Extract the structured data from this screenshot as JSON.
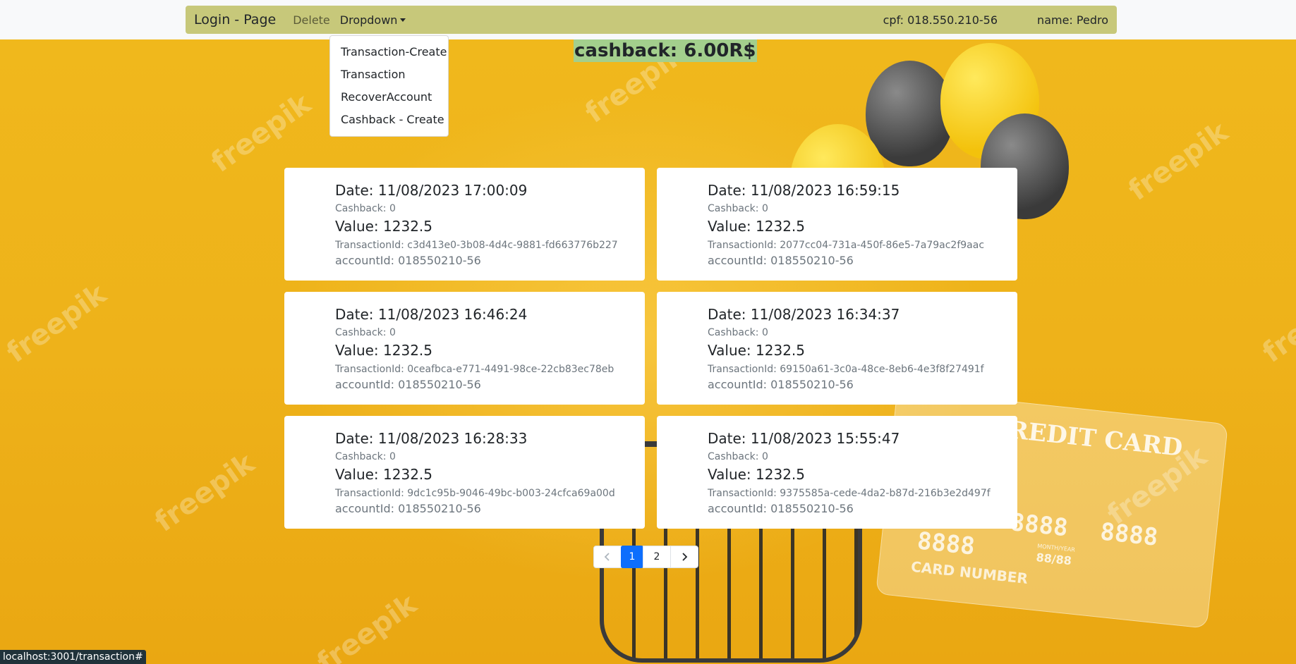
{
  "navbar": {
    "brand": "Login - Page",
    "delete_label": "Delete",
    "dropdown_label": "Dropdown",
    "cpf": "cpf: 018.550.210-56",
    "name": "name: Pedro"
  },
  "dropdown": {
    "items": [
      "Transaction-Create",
      "Transaction",
      "RecoverAccount",
      "Cashback - Create"
    ]
  },
  "cashback_title": "cashback: 6.00R$",
  "transactions": [
    {
      "date": "Date: 11/08/2023 17:00:09",
      "cashback": "Cashback: 0",
      "value": "Value: 1232.5",
      "transaction_id": "TransactionId: c3d413e0-3b08-4d4c-9881-fd663776b227",
      "account_id": "accountId: 018550210-56"
    },
    {
      "date": "Date: 11/08/2023 16:59:15",
      "cashback": "Cashback: 0",
      "value": "Value: 1232.5",
      "transaction_id": "TransactionId: 2077cc04-731a-450f-86e5-7a79ac2f9aac",
      "account_id": "accountId: 018550210-56"
    },
    {
      "date": "Date: 11/08/2023 16:46:24",
      "cashback": "Cashback: 0",
      "value": "Value: 1232.5",
      "transaction_id": "TransactionId: 0ceafbca-e771-4491-98ce-22cb83ec78eb",
      "account_id": "accountId: 018550210-56"
    },
    {
      "date": "Date: 11/08/2023 16:34:37",
      "cashback": "Cashback: 0",
      "value": "Value: 1232.5",
      "transaction_id": "TransactionId: 69150a61-3c0a-48ce-8eb6-4e3f8f27491f",
      "account_id": "accountId: 018550210-56"
    },
    {
      "date": "Date: 11/08/2023 16:28:33",
      "cashback": "Cashback: 0",
      "value": "Value: 1232.5",
      "transaction_id": "TransactionId: 9dc1c95b-9046-49bc-b003-24cfca69a00d",
      "account_id": "accountId: 018550210-56"
    },
    {
      "date": "Date: 11/08/2023 15:55:47",
      "cashback": "Cashback: 0",
      "value": "Value: 1232.5",
      "transaction_id": "TransactionId: 9375585a-cede-4da2-b87d-216b3e2d497f",
      "account_id": "accountId: 018550210-56"
    }
  ],
  "pagination": {
    "pages": [
      "1",
      "2"
    ],
    "active_page": "1",
    "prev_icon": "chevron-left-icon",
    "next_icon": "chevron-right-icon"
  },
  "background": {
    "watermark": "freepik",
    "card_title": "CREDIT CARD",
    "card_number": "8888 8888 8888 8888",
    "card_expiry_label": "MONTH/YEAR",
    "card_expiry": "88/88",
    "card_number_label": "CARD NUMBER"
  },
  "status_bar": "localhost:3001/transaction#",
  "colors": {
    "navbar_bg": "#c7c87a",
    "cashback_highlight": "#a3cf8d",
    "page_bg": "#eeb21a",
    "active_page": "#0d6efd"
  }
}
